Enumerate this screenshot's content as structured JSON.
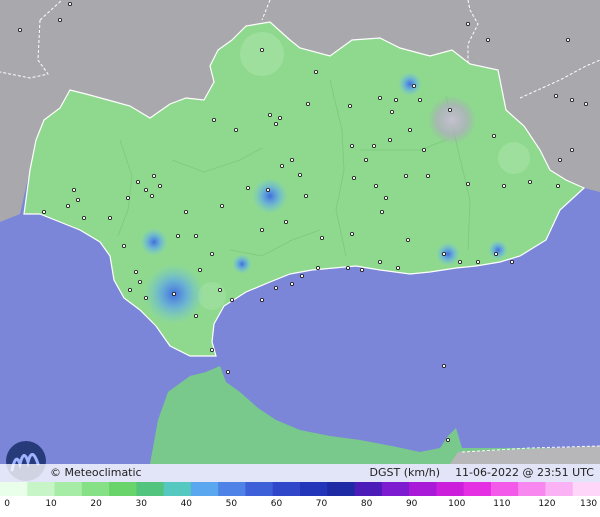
{
  "credit": {
    "copyright_symbol": "©",
    "name": "Meteoclimatic"
  },
  "info": {
    "variable": "DGST (km/h)",
    "datetime": "11-06-2022 @ 23:51 UTC"
  },
  "legend": {
    "min": 0,
    "max": 130,
    "ticks": [
      "0",
      "10",
      "20",
      "30",
      "40",
      "50",
      "60",
      "70",
      "80",
      "90",
      "100",
      "110",
      "120",
      "130"
    ],
    "colors": [
      "#eaffea",
      "#c8f5c8",
      "#a6eca6",
      "#86e086",
      "#69d469",
      "#52c47d",
      "#55c8c0",
      "#5aa7f0",
      "#4f82e6",
      "#3d5fd8",
      "#2f47c8",
      "#2335b8",
      "#1d2aa4",
      "#4b1cb8",
      "#7d1bd0",
      "#a81ad8",
      "#cc1fdc",
      "#e52fe2",
      "#f35ae9",
      "#f888ef",
      "#fbb2f5",
      "#fdd6fa"
    ]
  },
  "colors": {
    "sea": "#7b86d8",
    "land_outside": "#a7a7a7",
    "andalusia": "#8fd98f",
    "north_africa": "#79c98d"
  },
  "stations": [
    [
      262,
      50
    ],
    [
      214,
      120
    ],
    [
      236,
      130
    ],
    [
      270,
      115
    ],
    [
      276,
      124
    ],
    [
      280,
      118
    ],
    [
      292,
      160
    ],
    [
      282,
      166
    ],
    [
      300,
      175
    ],
    [
      268,
      190
    ],
    [
      154,
      176
    ],
    [
      160,
      186
    ],
    [
      146,
      190
    ],
    [
      152,
      196
    ],
    [
      138,
      182
    ],
    [
      128,
      198
    ],
    [
      74,
      190
    ],
    [
      78,
      200
    ],
    [
      68,
      206
    ],
    [
      84,
      218
    ],
    [
      44,
      212
    ],
    [
      110,
      218
    ],
    [
      124,
      246
    ],
    [
      136,
      272
    ],
    [
      140,
      282
    ],
    [
      130,
      290
    ],
    [
      146,
      298
    ],
    [
      174,
      294
    ],
    [
      200,
      270
    ],
    [
      212,
      254
    ],
    [
      220,
      290
    ],
    [
      232,
      300
    ],
    [
      196,
      316
    ],
    [
      212,
      350
    ],
    [
      262,
      230
    ],
    [
      286,
      222
    ],
    [
      306,
      196
    ],
    [
      322,
      238
    ],
    [
      318,
      268
    ],
    [
      302,
      276
    ],
    [
      292,
      284
    ],
    [
      276,
      288
    ],
    [
      262,
      300
    ],
    [
      348,
      268
    ],
    [
      352,
      234
    ],
    [
      362,
      270
    ],
    [
      380,
      262
    ],
    [
      398,
      268
    ],
    [
      408,
      240
    ],
    [
      382,
      212
    ],
    [
      386,
      198
    ],
    [
      376,
      186
    ],
    [
      354,
      178
    ],
    [
      366,
      160
    ],
    [
      352,
      146
    ],
    [
      374,
      146
    ],
    [
      390,
      140
    ],
    [
      410,
      130
    ],
    [
      420,
      100
    ],
    [
      414,
      86
    ],
    [
      396,
      100
    ],
    [
      392,
      112
    ],
    [
      380,
      98
    ],
    [
      350,
      106
    ],
    [
      308,
      104
    ],
    [
      316,
      72
    ],
    [
      444,
      254
    ],
    [
      460,
      262
    ],
    [
      478,
      262
    ],
    [
      496,
      254
    ],
    [
      512,
      262
    ],
    [
      504,
      186
    ],
    [
      530,
      182
    ],
    [
      558,
      186
    ],
    [
      560,
      160
    ],
    [
      572,
      150
    ],
    [
      556,
      96
    ],
    [
      572,
      100
    ],
    [
      586,
      104
    ],
    [
      568,
      40
    ],
    [
      20,
      30
    ],
    [
      60,
      20
    ],
    [
      70,
      4
    ],
    [
      468,
      24
    ],
    [
      488,
      40
    ],
    [
      424,
      150
    ],
    [
      406,
      176
    ],
    [
      450,
      110
    ],
    [
      428,
      176
    ],
    [
      468,
      184
    ],
    [
      494,
      136
    ],
    [
      248,
      188
    ],
    [
      222,
      206
    ],
    [
      186,
      212
    ],
    [
      196,
      236
    ],
    [
      178,
      236
    ],
    [
      448,
      440
    ],
    [
      444,
      366
    ],
    [
      228,
      372
    ]
  ]
}
